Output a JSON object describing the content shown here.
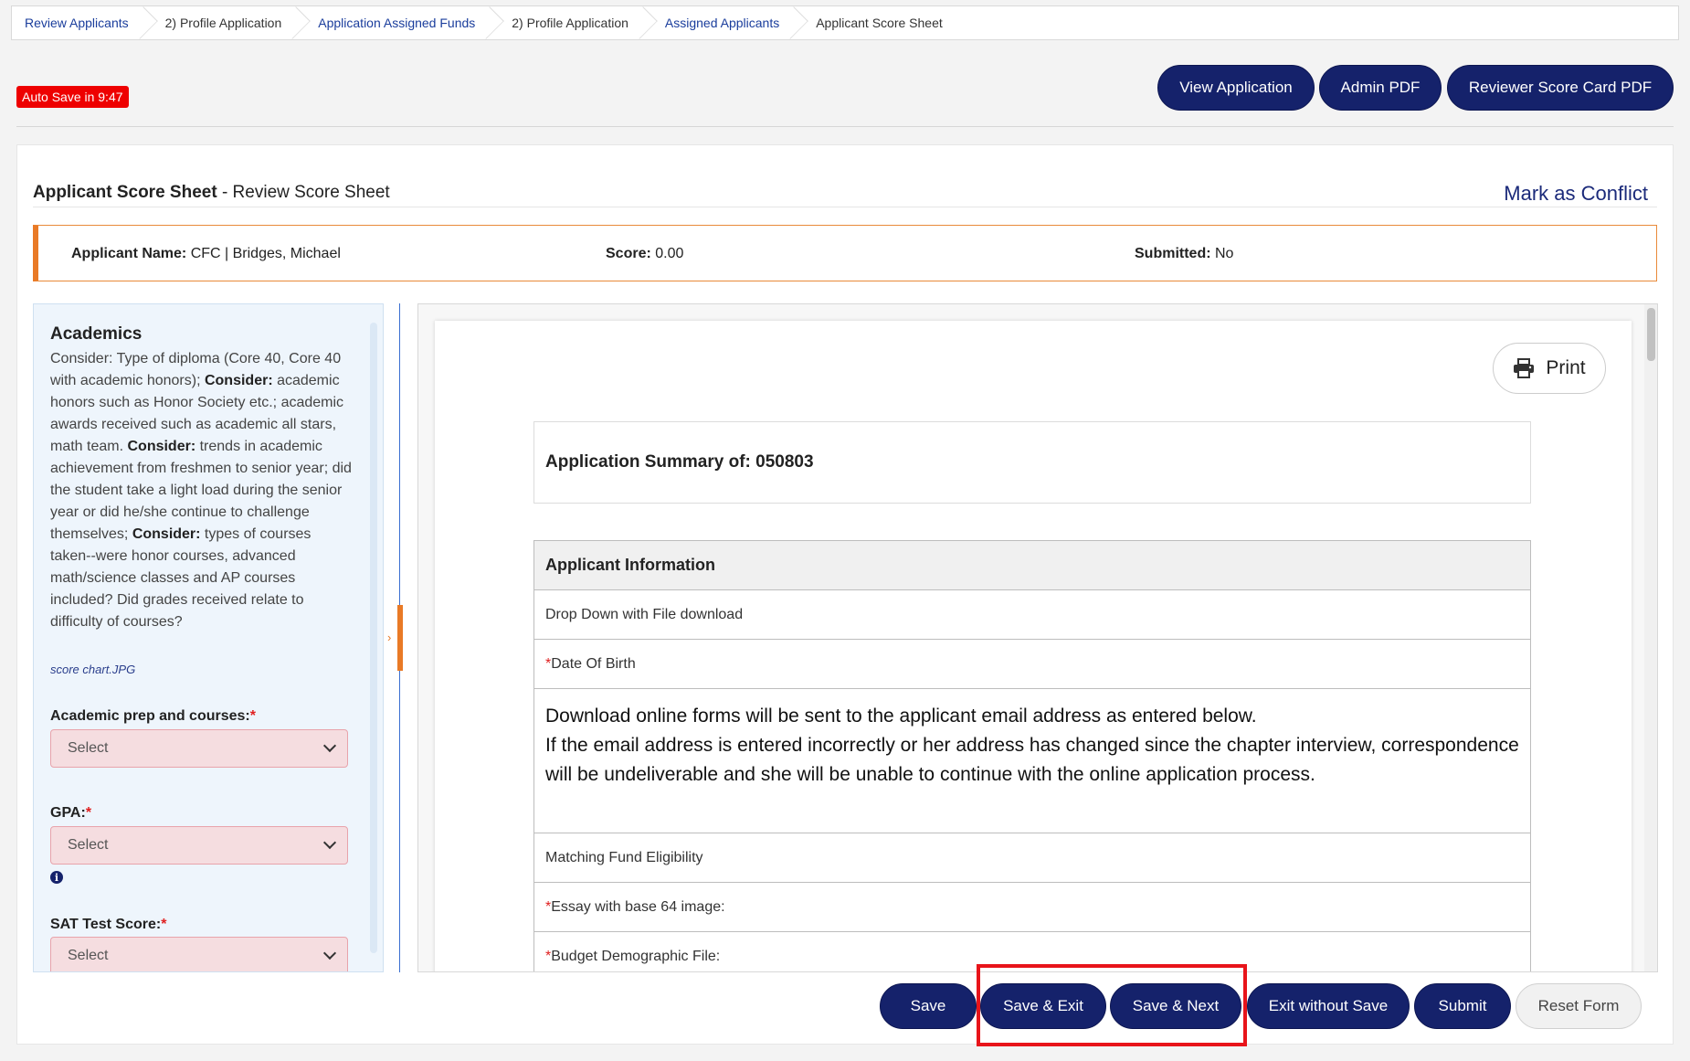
{
  "breadcrumb": [
    {
      "label": "Review Applicants",
      "link": true
    },
    {
      "label": "2) Profile Application",
      "link": false
    },
    {
      "label": "Application Assigned Funds",
      "link": true
    },
    {
      "label": "2) Profile Application",
      "link": false
    },
    {
      "label": "Assigned Applicants",
      "link": true
    },
    {
      "label": "Applicant Score Sheet",
      "link": false
    }
  ],
  "autosave": "Auto Save in 9:47",
  "top_buttons": {
    "view_application": "View Application",
    "admin_pdf": "Admin PDF",
    "reviewer_pdf": "Reviewer Score Card PDF"
  },
  "sheet": {
    "title_bold": "Applicant Score Sheet",
    "title_rest": " - Review Score Sheet",
    "mark_conflict": "Mark as Conflict"
  },
  "info": {
    "name_label": "Applicant Name:",
    "name_value": " CFC | Bridges, Michael",
    "score_label": "Score:",
    "score_value": " 0.00",
    "submitted_label": "Submitted:",
    "submitted_value": " No"
  },
  "left": {
    "section_title": "Academics",
    "desc_parts": [
      {
        "t": "Consider: Type of diploma (Core 40, Core 40 with academic honors); ",
        "b": false
      },
      {
        "t": "Consider:",
        "b": true
      },
      {
        "t": " academic honors such as Honor Society etc.; academic awards received such as academic all stars, math team. ",
        "b": false
      },
      {
        "t": "Consider:",
        "b": true
      },
      {
        "t": " trends in academic achievement from freshmen to senior year; did the student take a light load during the senior year or did he/she continue to challenge themselves; ",
        "b": false
      },
      {
        "t": "Consider:",
        "b": true
      },
      {
        "t": " types of courses taken--were honor courses, advanced math/science classes and AP courses included? Did grades received relate to difficulty of courses?",
        "b": false
      }
    ],
    "file_link": "score chart.JPG",
    "fields": {
      "prep_label": "Academic prep and courses:",
      "gpa_label": "GPA:",
      "sat_label": "SAT Test Score:",
      "required_mark": "*",
      "select_placeholder": "Select"
    }
  },
  "viewer": {
    "print_label": "Print",
    "summary_title": "Application Summary of: 050803",
    "rows": {
      "head": "Applicant Information",
      "r1": "Drop Down with File download",
      "r2_label": "Date Of Birth",
      "r3_line1": "Download online forms will be sent to the applicant email address as entered below.",
      "r3_line2": "If the email address is entered incorrectly or her address has changed since the chapter interview, correspondence will be undeliverable and she will be unable to continue with the online application process.",
      "r4": "Matching Fund Eligibility",
      "r5_label": "Essay with base 64 image:",
      "r6_label": "Budget Demographic File:",
      "required_mark": "*"
    }
  },
  "bottom_buttons": {
    "save": "Save",
    "save_exit": "Save & Exit",
    "save_next": "Save & Next",
    "exit_without_save": "Exit without Save",
    "submit": "Submit",
    "reset": "Reset Form"
  }
}
